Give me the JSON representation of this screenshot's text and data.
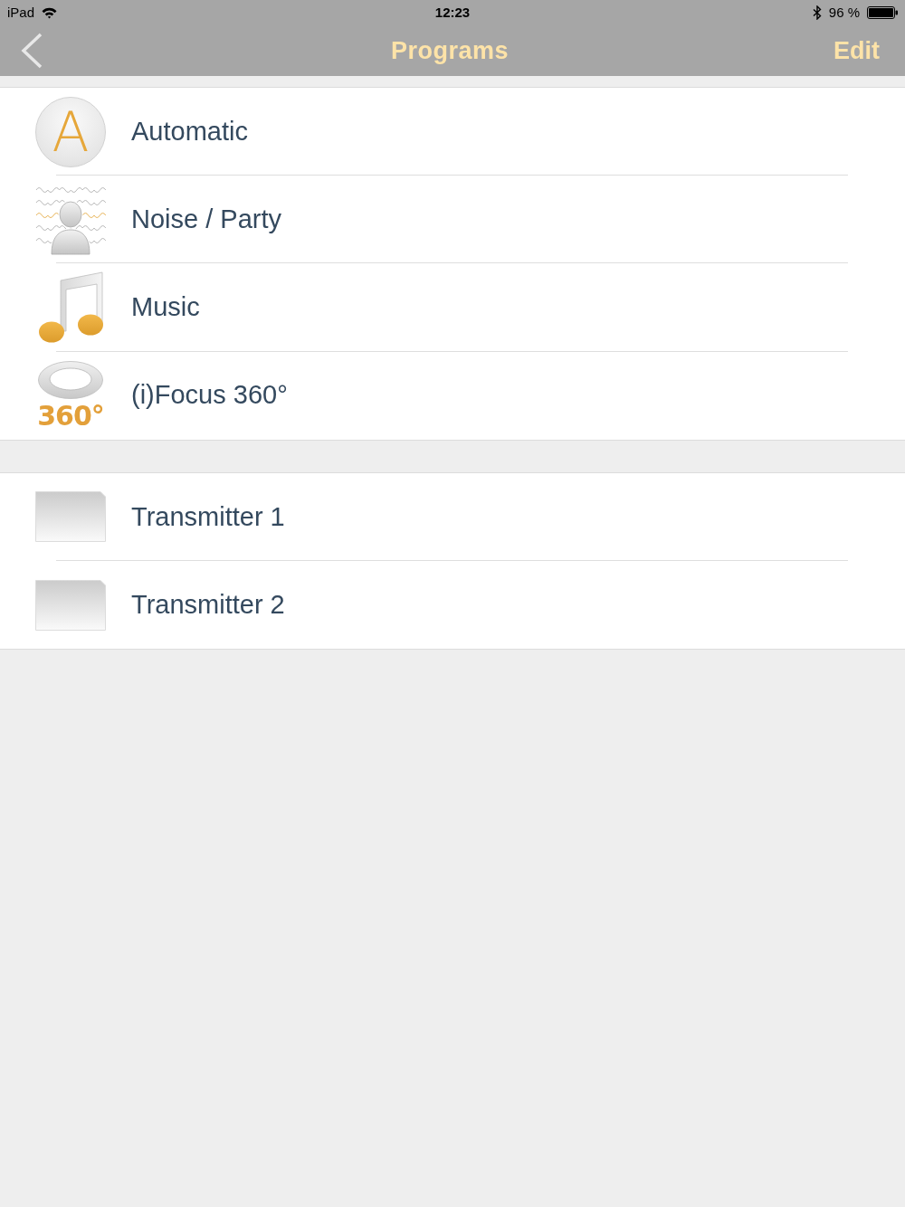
{
  "status_bar": {
    "device": "iPad",
    "time": "12:23",
    "battery": "96 %"
  },
  "nav": {
    "title": "Programs",
    "edit": "Edit"
  },
  "groups": [
    {
      "items": [
        {
          "label": "Automatic",
          "icon": {
            "kind": "letter",
            "text": "A"
          }
        },
        {
          "label": "Noise / Party",
          "icon": {
            "kind": "noise"
          }
        },
        {
          "label": "Music",
          "icon": {
            "kind": "music"
          }
        },
        {
          "label": "(i)Focus 360°",
          "icon": {
            "kind": "focus",
            "text": "360°"
          }
        }
      ]
    },
    {
      "items": [
        {
          "label": "Transmitter 1",
          "icon": {
            "kind": "blank"
          }
        },
        {
          "label": "Transmitter 2",
          "icon": {
            "kind": "blank"
          }
        }
      ]
    }
  ]
}
